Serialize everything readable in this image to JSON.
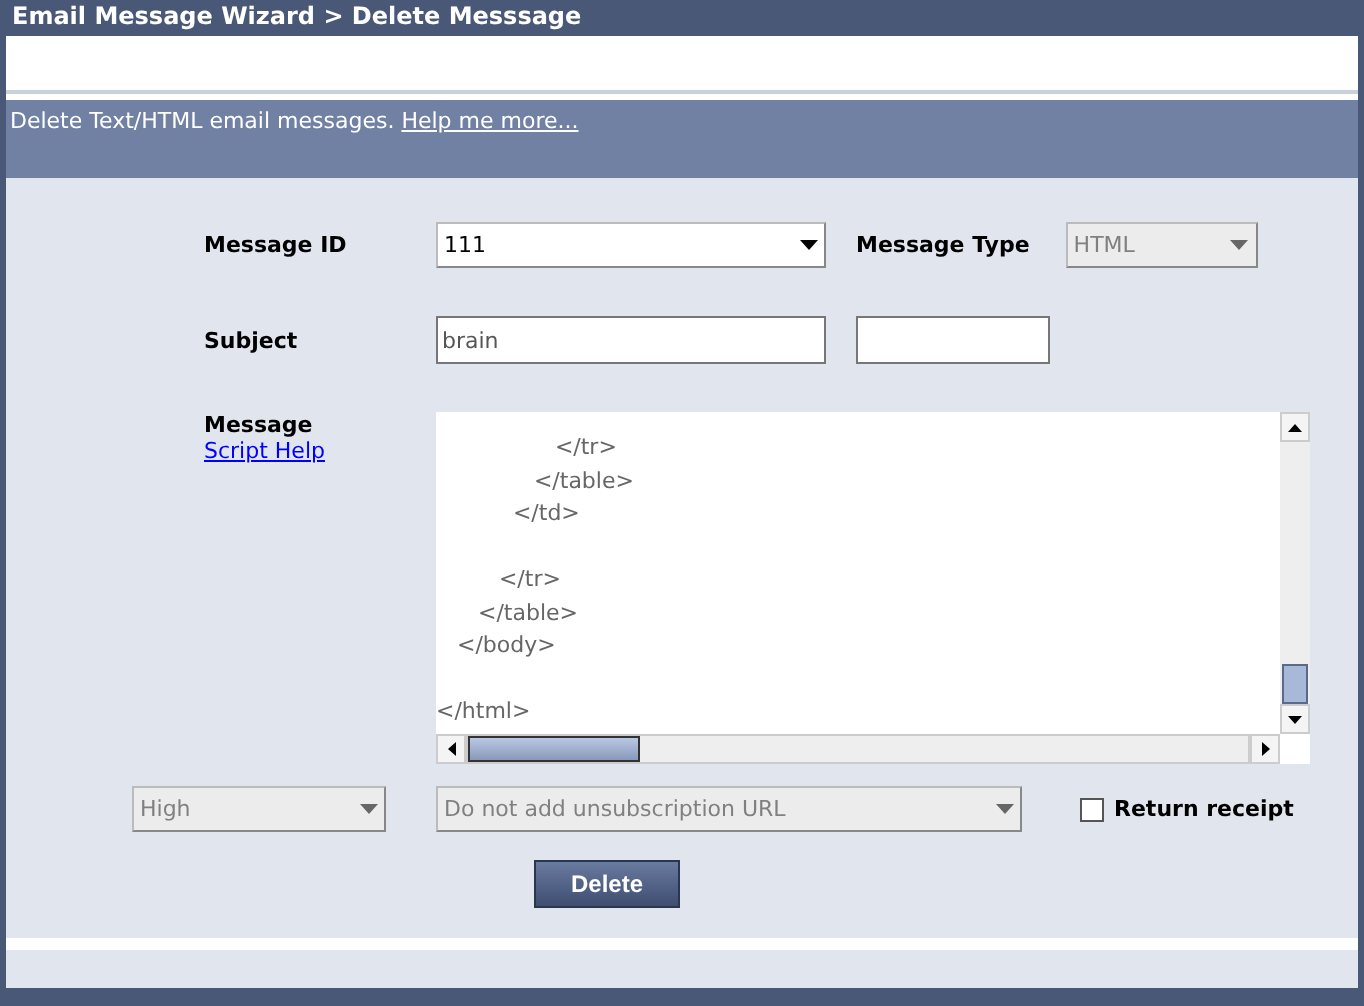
{
  "window": {
    "title": "Email Message Wizard > Delete Messsage"
  },
  "info_bar": {
    "text": "Delete Text/HTML email messages.",
    "link": "Help me more..."
  },
  "form": {
    "message_id": {
      "label": "Message ID",
      "value": "111",
      "disabled": false
    },
    "message_type": {
      "label": "Message Type",
      "value": "HTML",
      "disabled": true
    },
    "subject": {
      "label": "Subject",
      "value": "brain"
    },
    "message": {
      "label": "Message",
      "link": "Script Help",
      "text": "                 </tr>\n              </table>\n           </td>\n\n         </tr>\n      </table>\n   </body>\n\n</html>"
    },
    "priority": {
      "value": "High",
      "disabled": true
    },
    "unsubscribe": {
      "value": "Do not add unsubscription URL",
      "disabled": true
    },
    "return_receipt": {
      "label": "Return receipt",
      "checked": false
    }
  },
  "buttons": [
    {
      "label": "Delete"
    }
  ]
}
